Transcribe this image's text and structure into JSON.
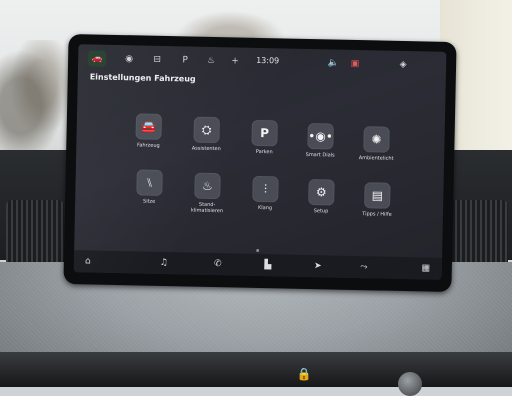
{
  "status_bar": {
    "clock": "13:09"
  },
  "screen": {
    "title": "Einstellungen Fahrzeug",
    "tiles": [
      {
        "label": "Fahrzeug",
        "icon": "car-icon"
      },
      {
        "label": "Assistenten",
        "icon": "assistant-icon"
      },
      {
        "label": "Parken",
        "icon": "parking-icon"
      },
      {
        "label": "Smart Dials",
        "icon": "smart-dials-icon"
      },
      {
        "label": "Ambientelicht",
        "icon": "ambient-light-icon"
      },
      {
        "label": "Sitze",
        "icon": "seat-icon"
      },
      {
        "label": "Stand-\nklimatisieren",
        "icon": "climate-icon"
      },
      {
        "label": "Klang",
        "icon": "sound-eq-icon"
      },
      {
        "label": "Setup",
        "icon": "gear-icon"
      },
      {
        "label": "Tipps / Hilfe",
        "icon": "help-book-icon"
      }
    ]
  },
  "colors": {
    "accent_green": "#49e38a",
    "hazard_orange": "#ff8a1c"
  }
}
